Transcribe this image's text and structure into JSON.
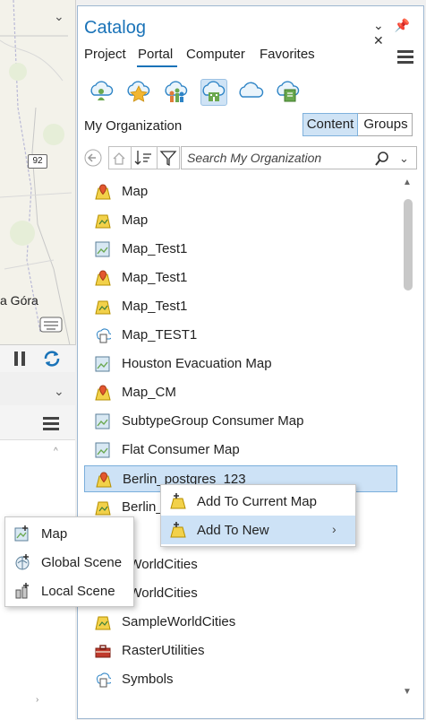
{
  "map": {
    "place_label": "a Góra",
    "road_number": "92"
  },
  "catalog": {
    "title": "Catalog",
    "tabs": [
      "Project",
      "Portal",
      "Computer",
      "Favorites"
    ],
    "active_tab": "Portal",
    "section_title": "My Organization",
    "segments": {
      "content": "Content",
      "groups": "Groups"
    },
    "search": {
      "placeholder": "Search My Organization"
    },
    "items": [
      {
        "label": "Map",
        "icon": "web-map-pin-icon"
      },
      {
        "label": "Map",
        "icon": "map-icon"
      },
      {
        "label": "Map_Test1",
        "icon": "map-package-icon"
      },
      {
        "label": "Map_Test1",
        "icon": "web-map-pin-icon"
      },
      {
        "label": "Map_Test1",
        "icon": "map-icon"
      },
      {
        "label": "Map_TEST1",
        "icon": "cloud-file-icon"
      },
      {
        "label": "Houston Evacuation Map",
        "icon": "map-package-icon"
      },
      {
        "label": "Map_CM",
        "icon": "web-map-pin-icon"
      },
      {
        "label": "SubtypeGroup Consumer Map",
        "icon": "map-package-icon"
      },
      {
        "label": "Flat Consumer Map",
        "icon": "map-package-icon"
      },
      {
        "label": "Berlin_postgres_123",
        "icon": "web-map-pin-icon"
      },
      {
        "label": "Berlin_",
        "icon": "map-icon"
      },
      {
        "label": "",
        "icon": ""
      },
      {
        "label": "eWorldCities",
        "icon": ""
      },
      {
        "label": "eWorldCities",
        "icon": ""
      },
      {
        "label": "SampleWorldCities",
        "icon": "map-icon"
      },
      {
        "label": "RasterUtilities",
        "icon": "toolbox-icon"
      },
      {
        "label": "Symbols",
        "icon": "cloud-file-icon"
      }
    ],
    "selected_index": 10
  },
  "context_menu": {
    "items": [
      "Add To Current Map",
      "Add To New"
    ],
    "add_to_new_underline": "N"
  },
  "submenu": {
    "items": [
      "Map",
      "Global Scene",
      "Local Scene"
    ]
  },
  "colors": {
    "accent": "#1a73b8",
    "selection": "#cde2f6"
  }
}
